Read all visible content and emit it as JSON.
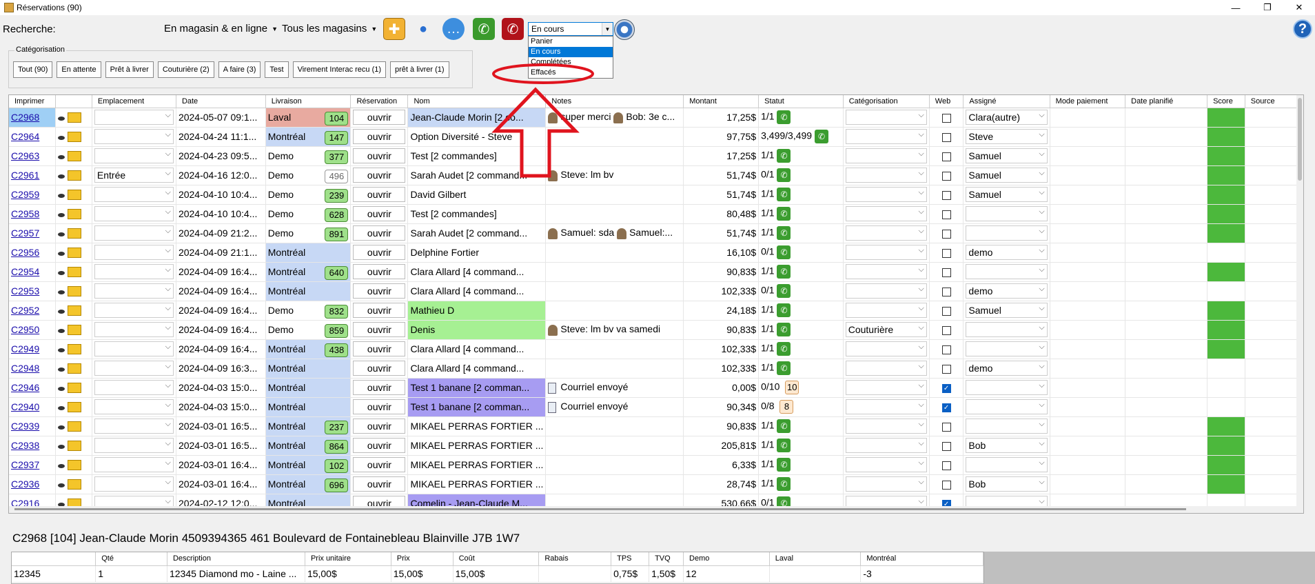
{
  "window": {
    "title": "Réservations (90)",
    "controls": [
      "—",
      "❐",
      "✕"
    ]
  },
  "toolbar": {
    "search_label": "Recherche:",
    "search_value": "",
    "channel_dd": "En magasin & en ligne",
    "store_dd": "Tous les magasins",
    "status_combo": "En cours",
    "status_options": [
      "Panier",
      "En cours",
      "Complétées",
      "Effacés"
    ],
    "status_selected_index": 1
  },
  "categorisation": {
    "legend": "Catégorisation",
    "buttons": [
      "Tout (90)",
      "En attente",
      "Prêt à livrer",
      "Couturière (2)",
      "A faire (3)",
      "Test",
      "Virement Interac recu (1)",
      "prêt à livrer (1)"
    ]
  },
  "grid": {
    "headers": [
      "Imprimer",
      "",
      "Emplacement",
      "Date",
      "Livraison",
      "Réservation",
      "Nom",
      "Notes",
      "Montant",
      "Statut",
      "Catégorisation",
      "Web",
      "Assigné",
      "Mode paiement",
      "Date planifié",
      "Score",
      "Source"
    ],
    "open_label": "ouvrir",
    "rows": [
      {
        "code": "C2968",
        "empl": "",
        "date": "2024-05-07 09:1...",
        "liv": "Laval",
        "livbg": "pink",
        "badge": "104",
        "nom": "Jean-Claude Morin [2 co...",
        "nombg": "blue",
        "notes": "super merci",
        "notes2": "Bob: 3e c...",
        "amt": "17,25$",
        "stat": "1/1",
        "cat": "",
        "web": false,
        "assign": "Clara(autre)",
        "score": true,
        "sel": true
      },
      {
        "code": "C2964",
        "empl": "",
        "date": "2024-04-24 11:1...",
        "liv": "Montréal",
        "livbg": "blue",
        "badge": "147",
        "nom": "Option Diversité - Steve",
        "nombg": "",
        "notes": "",
        "notes2": "",
        "amt": "97,75$",
        "stat": "3,499/3,499",
        "cat": "",
        "web": false,
        "assign": "Steve",
        "score": true
      },
      {
        "code": "C2963",
        "empl": "",
        "date": "2024-04-23 09:5...",
        "liv": "Demo",
        "livbg": "",
        "badge": "377",
        "nom": "Test [2 commandes]",
        "nombg": "",
        "notes": "",
        "notes2": "",
        "amt": "17,25$",
        "stat": "1/1",
        "cat": "",
        "web": false,
        "assign": "Samuel",
        "score": true
      },
      {
        "code": "C2961",
        "empl": "Entrée",
        "date": "2024-04-16 12:0...",
        "liv": "Demo",
        "livbg": "",
        "badge": "496",
        "badgegrey": true,
        "nom": "Sarah Audet [2 command...",
        "nombg": "",
        "notes": "Steve: lm bv",
        "notes2": "",
        "amt": "51,74$",
        "stat": "0/1",
        "cat": "",
        "web": false,
        "assign": "Samuel",
        "score": true
      },
      {
        "code": "C2959",
        "empl": "",
        "date": "2024-04-10 10:4...",
        "liv": "Demo",
        "livbg": "",
        "badge": "239",
        "nom": "David Gilbert",
        "nombg": "",
        "notes": "",
        "notes2": "",
        "amt": "51,74$",
        "stat": "1/1",
        "cat": "",
        "web": false,
        "assign": "Samuel",
        "score": true
      },
      {
        "code": "C2958",
        "empl": "",
        "date": "2024-04-10 10:4...",
        "liv": "Demo",
        "livbg": "",
        "badge": "628",
        "nom": "Test [2 commandes]",
        "nombg": "",
        "notes": "",
        "notes2": "",
        "amt": "80,48$",
        "stat": "1/1",
        "cat": "",
        "web": false,
        "assign": "",
        "score": true
      },
      {
        "code": "C2957",
        "empl": "",
        "date": "2024-04-09 21:2...",
        "liv": "Demo",
        "livbg": "",
        "badge": "891",
        "nom": "Sarah Audet [2 command...",
        "nombg": "",
        "notes": "Samuel: sda",
        "notes2": "Samuel:...",
        "amt": "51,74$",
        "stat": "1/1",
        "cat": "",
        "web": false,
        "assign": "",
        "score": true
      },
      {
        "code": "C2956",
        "empl": "",
        "date": "2024-04-09 21:1...",
        "liv": "Montréal",
        "livbg": "blue",
        "badge": "",
        "nom": "Delphine Fortier",
        "nombg": "",
        "notes": "",
        "notes2": "",
        "amt": "16,10$",
        "stat": "0/1",
        "cat": "",
        "web": false,
        "assign": "demo",
        "score": false
      },
      {
        "code": "C2954",
        "empl": "",
        "date": "2024-04-09 16:4...",
        "liv": "Montréal",
        "livbg": "blue",
        "badge": "640",
        "nom": "Clara Allard [4 command...",
        "nombg": "",
        "notes": "",
        "notes2": "",
        "amt": "90,83$",
        "stat": "1/1",
        "cat": "",
        "web": false,
        "assign": "",
        "score": true
      },
      {
        "code": "C2953",
        "empl": "",
        "date": "2024-04-09 16:4...",
        "liv": "Montréal",
        "livbg": "blue",
        "badge": "",
        "nom": "Clara Allard [4 command...",
        "nombg": "",
        "notes": "",
        "notes2": "",
        "amt": "102,33$",
        "stat": "0/1",
        "cat": "",
        "web": false,
        "assign": "demo",
        "score": false
      },
      {
        "code": "C2952",
        "empl": "",
        "date": "2024-04-09 16:4...",
        "liv": "Demo",
        "livbg": "",
        "badge": "832",
        "nom": "Mathieu D",
        "nombg": "green",
        "notes": "",
        "notes2": "",
        "amt": "24,18$",
        "stat": "1/1",
        "cat": "",
        "web": false,
        "assign": "Samuel",
        "score": true
      },
      {
        "code": "C2950",
        "empl": "",
        "date": "2024-04-09 16:4...",
        "liv": "Demo",
        "livbg": "",
        "badge": "859",
        "nom": "Denis",
        "nombg": "green",
        "notes": "Steve: lm bv va samedi",
        "notes2": "",
        "amt": "90,83$",
        "stat": "1/1",
        "cat": "Couturière",
        "web": false,
        "assign": "",
        "score": true
      },
      {
        "code": "C2949",
        "empl": "",
        "date": "2024-04-09 16:4...",
        "liv": "Montréal",
        "livbg": "blue",
        "badge": "438",
        "nom": "Clara Allard [4 command...",
        "nombg": "",
        "notes": "",
        "notes2": "",
        "amt": "102,33$",
        "stat": "1/1",
        "cat": "",
        "web": false,
        "assign": "",
        "score": true
      },
      {
        "code": "C2948",
        "empl": "",
        "date": "2024-04-09 16:3...",
        "liv": "Montréal",
        "livbg": "blue",
        "badge": "",
        "nom": "Clara Allard [4 command...",
        "nombg": "",
        "notes": "",
        "notes2": "",
        "amt": "102,33$",
        "stat": "1/1",
        "cat": "",
        "web": false,
        "assign": "demo",
        "score": false
      },
      {
        "code": "C2946",
        "empl": "",
        "date": "2024-04-03 15:0...",
        "liv": "Montréal",
        "livbg": "blue",
        "badge": "",
        "nom": "Test 1 banane [2 comman...",
        "nombg": "purple",
        "notes": "Courriel envoyé",
        "notes2": "",
        "amt": "0,00$",
        "stat": "0/10",
        "num": "10",
        "cat": "",
        "web": true,
        "assign": "",
        "score": false
      },
      {
        "code": "C2940",
        "empl": "",
        "date": "2024-04-03 15:0...",
        "liv": "Montréal",
        "livbg": "blue",
        "badge": "",
        "nom": "Test 1 banane [2 comman...",
        "nombg": "purple",
        "notes": "Courriel envoyé",
        "notes2": "",
        "amt": "90,34$",
        "stat": "0/8",
        "num": "8",
        "cat": "",
        "web": true,
        "assign": "",
        "score": false
      },
      {
        "code": "C2939",
        "empl": "",
        "date": "2024-03-01 16:5...",
        "liv": "Montréal",
        "livbg": "blue",
        "badge": "237",
        "nom": "MIKAEL PERRAS FORTIER ...",
        "nombg": "",
        "notes": "",
        "notes2": "",
        "amt": "90,83$",
        "stat": "1/1",
        "cat": "",
        "web": false,
        "assign": "",
        "score": true
      },
      {
        "code": "C2938",
        "empl": "",
        "date": "2024-03-01 16:5...",
        "liv": "Montréal",
        "livbg": "blue",
        "badge": "864",
        "nom": "MIKAEL PERRAS FORTIER ...",
        "nombg": "",
        "notes": "",
        "notes2": "",
        "amt": "205,81$",
        "stat": "1/1",
        "cat": "",
        "web": false,
        "assign": "Bob",
        "score": true
      },
      {
        "code": "C2937",
        "empl": "",
        "date": "2024-03-01 16:4...",
        "liv": "Montréal",
        "livbg": "blue",
        "badge": "102",
        "nom": "MIKAEL PERRAS FORTIER ...",
        "nombg": "",
        "notes": "",
        "notes2": "",
        "amt": "6,33$",
        "stat": "1/1",
        "cat": "",
        "web": false,
        "assign": "",
        "score": true
      },
      {
        "code": "C2936",
        "empl": "",
        "date": "2024-03-01 16:4...",
        "liv": "Montréal",
        "livbg": "blue",
        "badge": "696",
        "nom": "MIKAEL PERRAS FORTIER ...",
        "nombg": "",
        "notes": "",
        "notes2": "",
        "amt": "28,74$",
        "stat": "1/1",
        "cat": "",
        "web": false,
        "assign": "Bob",
        "score": true
      },
      {
        "code": "C2916",
        "empl": "",
        "date": "2024-02-12 12:0...",
        "liv": "Montréal",
        "livbg": "blue",
        "badge": "",
        "nom": "Comelin - Jean-Claude M...",
        "nombg": "purple",
        "notes": "",
        "notes2": "",
        "amt": "530,66$",
        "stat": "0/1",
        "cat": "",
        "web": true,
        "assign": "",
        "score": false
      }
    ]
  },
  "footer": {
    "info": "C2968 [104] Jean-Claude Morin 4509394365  461 Boulevard de Fontainebleau Blainville J7B 1W7"
  },
  "detail": {
    "headers": [
      "",
      "Qté",
      "Description",
      "Prix unitaire",
      "Prix",
      "Coût",
      "Rabais",
      "TPS",
      "TVQ",
      "Demo",
      "Laval",
      "Montréal"
    ],
    "row": [
      "12345",
      "1",
      "12345 Diamond  mo - Laine ...",
      "15,00$",
      "15,00$",
      "15,00$",
      "",
      "0,75$",
      "1,50$",
      "12",
      "",
      "-3"
    ]
  },
  "colors": {
    "accent": "#0078d7",
    "score": "#4cb83c",
    "badge": "#9fe08a",
    "annotation": "#e0141e"
  }
}
